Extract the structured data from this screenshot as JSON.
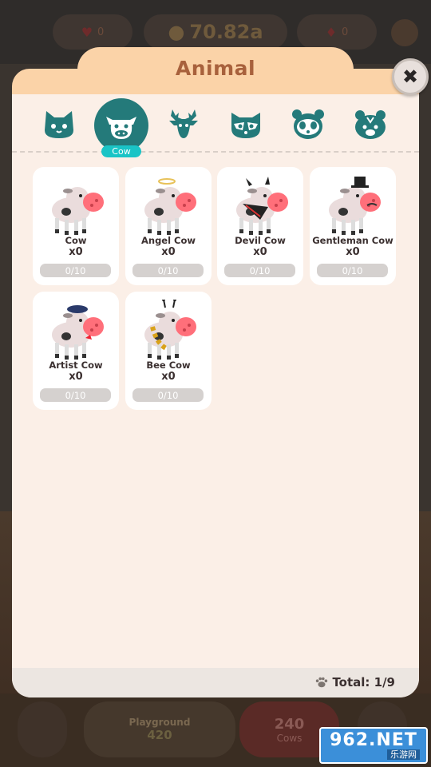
{
  "background": {
    "money": "70.82a",
    "hearts_left": "0",
    "hearts_right": "0",
    "playground": {
      "title": "Playground",
      "value": "420"
    },
    "buy": {
      "value": "240",
      "label": "Cows"
    }
  },
  "modal": {
    "title": "Animal",
    "close_icon": "close-icon",
    "categories": [
      {
        "icon": "cat-icon",
        "label": ""
      },
      {
        "icon": "cow-icon",
        "label": "Cow",
        "active": true
      },
      {
        "icon": "deer-icon",
        "label": ""
      },
      {
        "icon": "raccoon-icon",
        "label": ""
      },
      {
        "icon": "panda-icon",
        "label": ""
      },
      {
        "icon": "hamster-icon",
        "label": ""
      }
    ],
    "active_category_label": "Cow",
    "animals": [
      {
        "name": "Cow",
        "count": "x0",
        "progress": "0/10",
        "accessory": "none"
      },
      {
        "name": "Angel Cow",
        "count": "x0",
        "progress": "0/10",
        "accessory": "halo"
      },
      {
        "name": "Devil Cow",
        "count": "x0",
        "progress": "0/10",
        "accessory": "horns"
      },
      {
        "name": "Gentleman Cow",
        "count": "x0",
        "progress": "0/10",
        "accessory": "tophat"
      },
      {
        "name": "Artist Cow",
        "count": "x0",
        "progress": "0/10",
        "accessory": "beret"
      },
      {
        "name": "Bee Cow",
        "count": "x0",
        "progress": "0/10",
        "accessory": "bee"
      }
    ],
    "footer": {
      "total": "Total: 1/9",
      "icon": "paw-icon"
    }
  },
  "watermark": {
    "main": "962.NET",
    "sub": "乐游网"
  },
  "colors": {
    "accent_teal": "#247a7a",
    "tab_label_bg": "#1ac4c6",
    "header_peach": "#fbd3a8",
    "title_brown": "#a8613c"
  }
}
